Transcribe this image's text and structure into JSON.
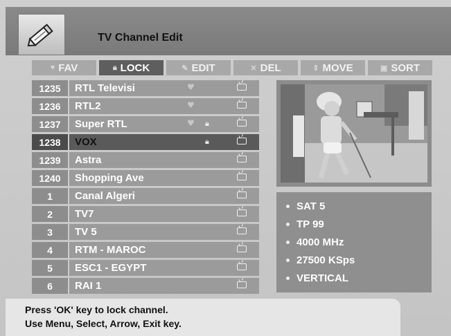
{
  "header": {
    "title": "TV Channel Edit",
    "icon": "pencil-icon"
  },
  "tabs": [
    {
      "label": "FAV",
      "icon": "heart-icon",
      "active": false
    },
    {
      "label": "LOCK",
      "icon": "lock-icon",
      "active": true
    },
    {
      "label": "EDIT",
      "icon": "edit-icon",
      "active": false
    },
    {
      "label": "DEL",
      "icon": "delete-icon",
      "active": false
    },
    {
      "label": "MOVE",
      "icon": "move-icon",
      "active": false
    },
    {
      "label": "SORT",
      "icon": "sort-icon",
      "active": false
    }
  ],
  "channels": [
    {
      "num": "1235",
      "name": "RTL Televisi",
      "fav": true,
      "locked": false,
      "selected": false
    },
    {
      "num": "1236",
      "name": "RTL2",
      "fav": true,
      "locked": false,
      "selected": false
    },
    {
      "num": "1237",
      "name": "Super RTL",
      "fav": true,
      "locked": true,
      "selected": false
    },
    {
      "num": "1238",
      "name": "VOX",
      "fav": false,
      "locked": true,
      "selected": true
    },
    {
      "num": "1239",
      "name": "Astra",
      "fav": false,
      "locked": false,
      "selected": false
    },
    {
      "num": "1240",
      "name": "Shopping Ave",
      "fav": false,
      "locked": false,
      "selected": false
    },
    {
      "num": "1",
      "name": "Canal Algeri",
      "fav": false,
      "locked": false,
      "selected": false
    },
    {
      "num": "2",
      "name": "TV7",
      "fav": false,
      "locked": false,
      "selected": false
    },
    {
      "num": "3",
      "name": "TV 5",
      "fav": false,
      "locked": false,
      "selected": false
    },
    {
      "num": "4",
      "name": "RTM - MAROC",
      "fav": false,
      "locked": false,
      "selected": false
    },
    {
      "num": "5",
      "name": "ESC1 - EGYPT",
      "fav": false,
      "locked": false,
      "selected": false
    },
    {
      "num": "6",
      "name": "RAI 1",
      "fav": false,
      "locked": false,
      "selected": false
    }
  ],
  "info": {
    "sat": "SAT 5",
    "tp": "TP 99",
    "freq": "4000 MHz",
    "symbol_rate": "27500 KSps",
    "polarity": "VERTICAL"
  },
  "footer": {
    "line1": "Press 'OK' key to lock channel.",
    "line2": "Use Menu, Select, Arrow, Exit key."
  }
}
